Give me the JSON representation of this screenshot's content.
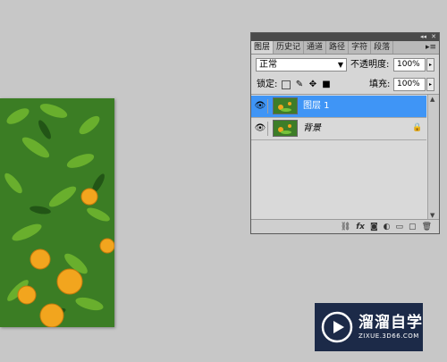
{
  "canvas": {
    "image": "orange-tree-photo"
  },
  "layers_panel": {
    "title_controls": {
      "collapse": "◂◂",
      "close": "✕"
    },
    "tabs": [
      {
        "label": "图层",
        "active": true
      },
      {
        "label": "历史记",
        "active": false
      },
      {
        "label": "通道",
        "active": false
      },
      {
        "label": "路径",
        "active": false
      },
      {
        "label": "字符",
        "active": false
      },
      {
        "label": "段落",
        "active": false
      }
    ],
    "panel_menu": "▸≡",
    "blend_mode": "正常",
    "opacity_label": "不透明度:",
    "opacity_value": "100%",
    "lock_label": "锁定:",
    "fill_label": "填充:",
    "fill_value": "100%",
    "layers": [
      {
        "name": "图层 1",
        "selected": true,
        "visible": true
      },
      {
        "name": "背景",
        "selected": false,
        "visible": true,
        "locked": true
      }
    ],
    "bottom_icons": [
      "link-icon",
      "fx-icon",
      "mask-icon",
      "adjustment-icon",
      "group-icon",
      "new-layer-icon",
      "trash-icon"
    ]
  },
  "watermark": {
    "title": "溜溜自学",
    "url": "ZIXUE.3D66.COM"
  }
}
